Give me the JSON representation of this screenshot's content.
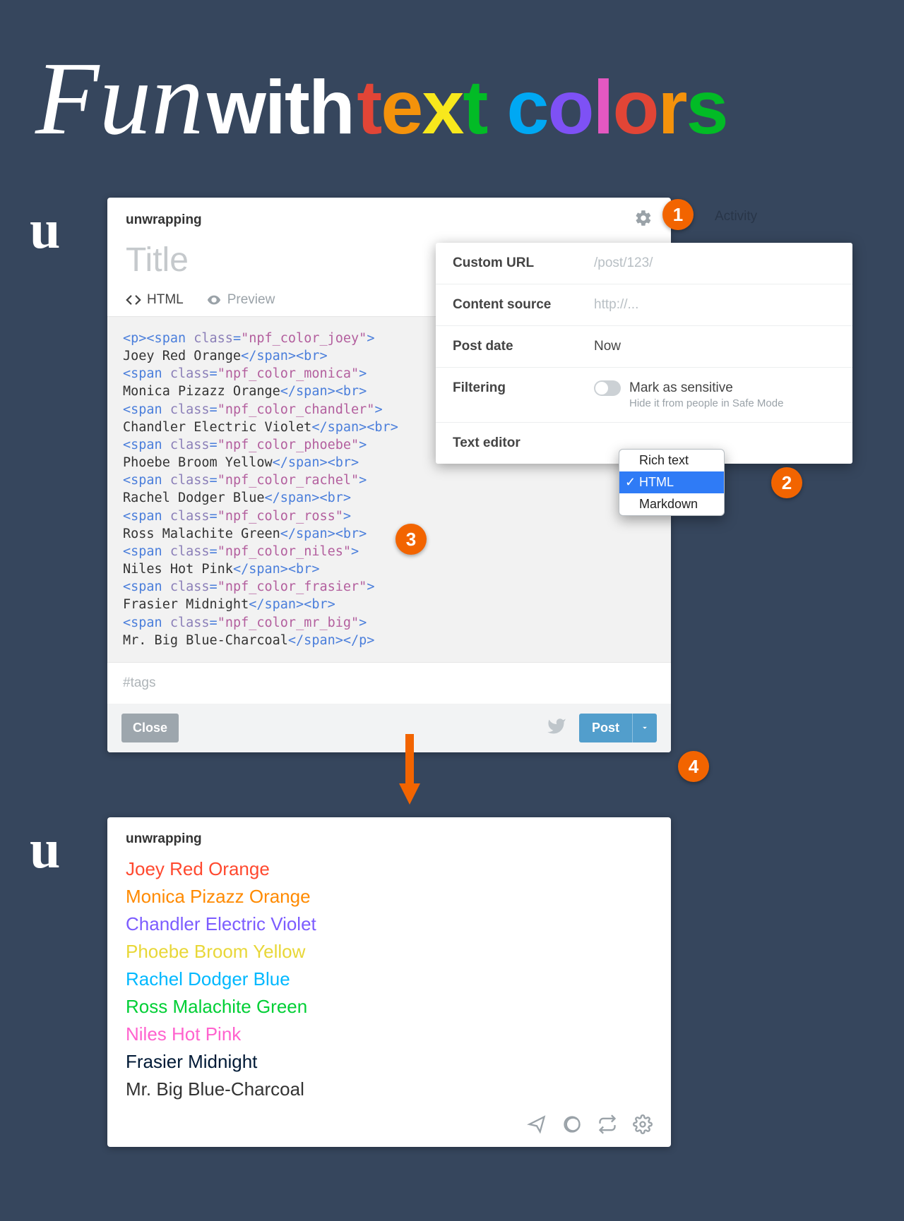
{
  "heading": {
    "cursive": "Fun",
    "with": "with",
    "text_letters": [
      "t",
      "e",
      "x",
      "t"
    ],
    "colors_letters": [
      "c",
      "o",
      "l",
      "o",
      "r",
      "s"
    ]
  },
  "avatar_letter": "u",
  "activity_label": "Activity",
  "editor": {
    "blog_name": "unwrapping",
    "title_placeholder": "Title",
    "tab_html": "HTML",
    "tab_preview": "Preview",
    "tags_placeholder": "#tags",
    "close_label": "Close",
    "post_label": "Post",
    "code_lines": [
      {
        "class": "npf_color_joey",
        "text": "Joey Red Orange",
        "is_first": true
      },
      {
        "class": "npf_color_monica",
        "text": "Monica Pizazz Orange"
      },
      {
        "class": "npf_color_chandler",
        "text": "Chandler Electric Violet"
      },
      {
        "class": "npf_color_phoebe",
        "text": "Phoebe Broom Yellow"
      },
      {
        "class": "npf_color_rachel",
        "text": "Rachel Dodger Blue"
      },
      {
        "class": "npf_color_ross",
        "text": "Ross Malachite Green"
      },
      {
        "class": "npf_color_niles",
        "text": "Niles Hot Pink"
      },
      {
        "class": "npf_color_frasier",
        "text": "Frasier Midnight"
      },
      {
        "class": "npf_color_mr_big",
        "text": "Mr. Big Blue-Charcoal",
        "is_last": true
      }
    ]
  },
  "settings": {
    "custom_url_label": "Custom URL",
    "custom_url_placeholder": "/post/123/",
    "content_source_label": "Content source",
    "content_source_placeholder": "http://...",
    "post_date_label": "Post date",
    "post_date_value": "Now",
    "filtering_label": "Filtering",
    "mark_sensitive": "Mark as sensitive",
    "mark_sensitive_sub": "Hide it from people in Safe Mode",
    "text_editor_label": "Text editor",
    "dropdown": {
      "rich": "Rich text",
      "html": "HTML",
      "markdown": "Markdown"
    }
  },
  "steps": {
    "s1": "1",
    "s2": "2",
    "s3": "3",
    "s4": "4"
  },
  "preview": {
    "blog_name": "unwrapping",
    "lines": [
      {
        "text": "Joey Red Orange",
        "cls": "ln-red"
      },
      {
        "text": "Monica Pizazz Orange",
        "cls": "ln-orange"
      },
      {
        "text": "Chandler Electric Violet",
        "cls": "ln-violet"
      },
      {
        "text": "Phoebe Broom Yellow",
        "cls": "ln-yellow"
      },
      {
        "text": "Rachel Dodger Blue",
        "cls": "ln-blue"
      },
      {
        "text": "Ross Malachite Green",
        "cls": "ln-green"
      },
      {
        "text": "Niles Hot Pink",
        "cls": "ln-pink"
      },
      {
        "text": "Frasier Midnight",
        "cls": "ln-midnight"
      },
      {
        "text": "Mr. Big Blue-Charcoal",
        "cls": "ln-charcoal"
      }
    ]
  }
}
